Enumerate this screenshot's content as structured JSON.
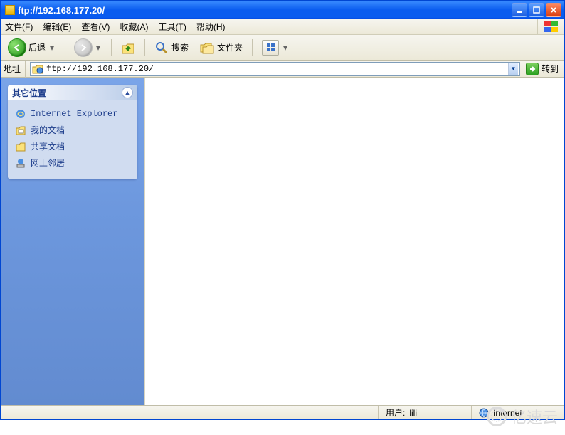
{
  "titlebar": {
    "title": "ftp://192.168.177.20/"
  },
  "menu": {
    "file": {
      "label": "文件",
      "accel": "F"
    },
    "edit": {
      "label": "编辑",
      "accel": "E"
    },
    "view": {
      "label": "查看",
      "accel": "V"
    },
    "fav": {
      "label": "收藏",
      "accel": "A"
    },
    "tools": {
      "label": "工具",
      "accel": "T"
    },
    "help": {
      "label": "帮助",
      "accel": "H"
    }
  },
  "toolbar": {
    "back_label": "后退",
    "search_label": "搜索",
    "folders_label": "文件夹"
  },
  "address": {
    "label": "地址",
    "url": "ftp://192.168.177.20/",
    "go_label": "转到"
  },
  "sidebar": {
    "title": "其它位置",
    "items": [
      {
        "label": "Internet Explorer"
      },
      {
        "label": "我的文档"
      },
      {
        "label": "共享文档"
      },
      {
        "label": "网上邻居"
      }
    ]
  },
  "status": {
    "user_label": "用户:",
    "user_value": "lili",
    "zone_label": "Internet"
  },
  "watermark": {
    "text": "亿速云"
  }
}
